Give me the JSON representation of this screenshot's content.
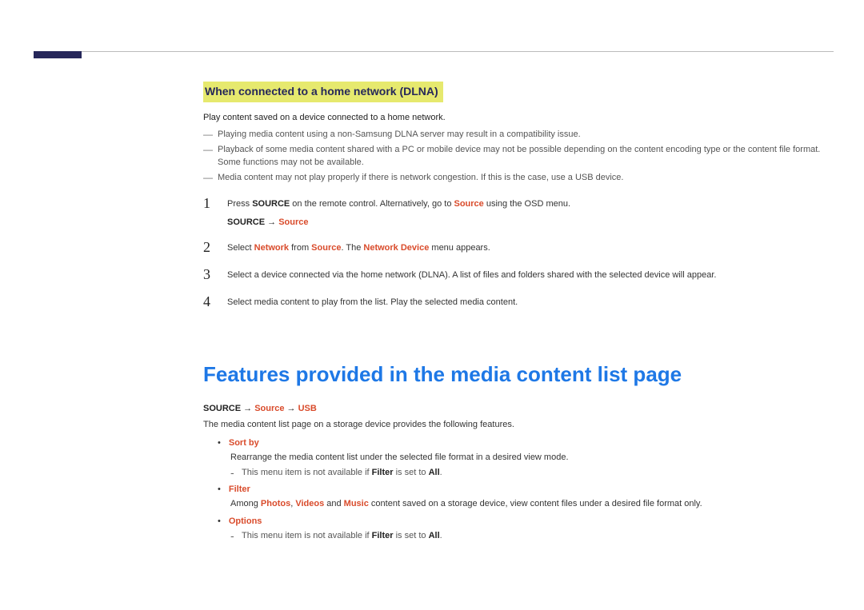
{
  "s1": {
    "heading": "When connected to a home network (DLNA)",
    "intro": "Play content saved on a device connected to a home network.",
    "notes": [
      "Playing media content using a non-Samsung DLNA server may result in a compatibility issue.",
      "Playback of some media content shared with a PC or mobile device may not be possible depending on the content encoding type or the content file format. Some functions may not be available.",
      "Media content may not play properly if there is network congestion. If this is the case, use a USB device."
    ],
    "steps": {
      "s1a": "Press ",
      "s1b": "SOURCE",
      "s1c": " on the remote control. Alternatively, go to ",
      "s1d": "Source",
      "s1e": " using the OSD menu.",
      "s1path_a": "SOURCE",
      "s1path_arrow": " → ",
      "s1path_b": "Source",
      "s2a": "Select ",
      "s2b": "Network",
      "s2c": " from ",
      "s2d": "Source",
      "s2e": ". The ",
      "s2f": "Network Device",
      "s2g": " menu appears.",
      "s3": "Select a device connected via the home network (DLNA). A list of files and folders shared with the selected device will appear.",
      "s4": "Select media content to play from the list. Play the selected media content."
    }
  },
  "s2": {
    "title": "Features provided in the media content list page",
    "path_a": "SOURCE",
    "path_arr1": " → ",
    "path_b": "Source",
    "path_arr2": " → ",
    "path_c": "USB",
    "desc": "The media content list page on a storage device provides the following features.",
    "items": {
      "i1": {
        "name": "Sort by",
        "sub": "Rearrange the media content list under the selected file format in a desired view mode.",
        "dash_a": "This menu item is not available if ",
        "dash_b": "Filter",
        "dash_c": " is set to ",
        "dash_d": "All",
        "dash_e": "."
      },
      "i2": {
        "name": "Filter",
        "sub_a": "Among ",
        "sub_b": "Photos",
        "sub_c": ", ",
        "sub_d": "Videos",
        "sub_e": " and ",
        "sub_f": "Music",
        "sub_g": " content saved on a storage device, view content files under a desired file format only."
      },
      "i3": {
        "name": "Options",
        "dash_a": "This menu item is not available if ",
        "dash_b": "Filter",
        "dash_c": " is set to ",
        "dash_d": "All",
        "dash_e": "."
      }
    }
  }
}
